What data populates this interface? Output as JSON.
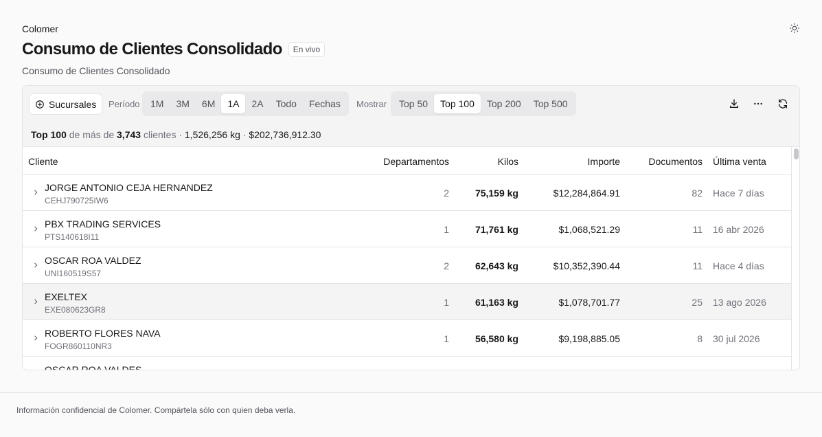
{
  "header": {
    "org": "Colomer",
    "title": "Consumo de Clientes Consolidado",
    "live_badge": "En vivo",
    "subtitle": "Consumo de Clientes Consolidado"
  },
  "toolbar": {
    "branches_label": "Sucursales",
    "period_label": "Período",
    "periods": [
      "1M",
      "3M",
      "6M",
      "1A",
      "2A",
      "Todo",
      "Fechas"
    ],
    "period_selected": "1A",
    "show_label": "Mostrar",
    "tops": [
      "Top 50",
      "Top 100",
      "Top 200",
      "Top 500"
    ],
    "top_selected": "Top 100"
  },
  "summary": {
    "top": "Top 100",
    "of_more_than": "de más de",
    "client_count": "3,743",
    "clients_word": "clientes",
    "sep": "·",
    "total_kg": "1,526,256 kg",
    "total_amount": "$202,736,912.30"
  },
  "table": {
    "columns": {
      "client": "Cliente",
      "departments": "Departamentos",
      "kilos": "Kilos",
      "amount": "Importe",
      "documents": "Documentos",
      "last_sale": "Última venta"
    },
    "rows": [
      {
        "name": "JORGE ANTONIO CEJA HERNANDEZ",
        "rfc": "CEHJ790725IW6",
        "departments": "2",
        "kilos": "75,159 kg",
        "amount": "$12,284,864.91",
        "documents": "82",
        "last_sale": "Hace 7 días"
      },
      {
        "name": "PBX TRADING SERVICES",
        "rfc": "PTS140618I11",
        "departments": "1",
        "kilos": "71,761 kg",
        "amount": "$1,068,521.29",
        "documents": "11",
        "last_sale": "16 abr 2026"
      },
      {
        "name": "OSCAR ROA VALDEZ",
        "rfc": "UNI160519S57",
        "departments": "2",
        "kilos": "62,643 kg",
        "amount": "$10,352,390.44",
        "documents": "11",
        "last_sale": "Hace 4 días"
      },
      {
        "name": "EXELTEX",
        "rfc": "EXE080623GR8",
        "departments": "1",
        "kilos": "61,163 kg",
        "amount": "$1,078,701.77",
        "documents": "25",
        "last_sale": "13 ago 2026"
      },
      {
        "name": "ROBERTO FLORES NAVA",
        "rfc": "FOGR860110NR3",
        "departments": "1",
        "kilos": "56,580 kg",
        "amount": "$9,198,885.05",
        "documents": "8",
        "last_sale": "30 jul 2026"
      },
      {
        "name": "OSCAR ROA VALDES",
        "rfc": "",
        "departments": "",
        "kilos": "",
        "amount": "",
        "documents": "",
        "last_sale": ""
      }
    ]
  },
  "footer": {
    "text": "Información confidencial de Colomer. Compártela sólo con quien deba verla."
  },
  "icons": {
    "theme": "sun-icon",
    "add": "plus-circle-icon",
    "download": "download-icon",
    "more": "more-horizontal-icon",
    "refresh": "refresh-icon",
    "expand": "chevron-right-icon"
  }
}
